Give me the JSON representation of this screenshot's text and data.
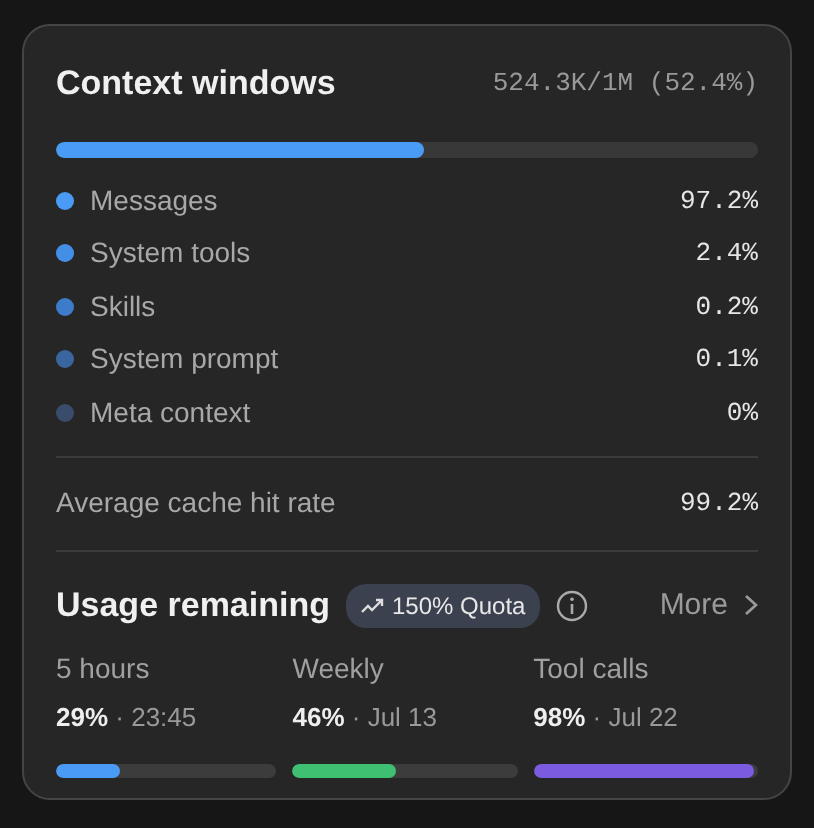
{
  "context": {
    "title": "Context windows",
    "summary": "524.3K/1M (52.4%)",
    "level": 0.524,
    "items": [
      {
        "label": "Messages",
        "value": "97.2%",
        "color": "#4a9bf5"
      },
      {
        "label": "System tools",
        "value": "2.4%",
        "color": "#438fe6"
      },
      {
        "label": "Skills",
        "value": "0.2%",
        "color": "#3d7ccb"
      },
      {
        "label": "System prompt",
        "value": "0.1%",
        "color": "#3a66a0"
      },
      {
        "label": "Meta context",
        "value": "0%",
        "color": "#394c6c"
      }
    ]
  },
  "cache": {
    "label": "Average cache hit rate",
    "value": "99.2%"
  },
  "usage": {
    "title": "Usage remaining",
    "badge": "150% Quota",
    "more": "More",
    "items": [
      {
        "label": "5 hours",
        "percent": "29%",
        "detail": "· 23:45",
        "level": 0.29,
        "color": "#4a9bf5"
      },
      {
        "label": "Weekly",
        "percent": "46%",
        "detail": "· Jul 13",
        "level": 0.46,
        "color": "#3fbf72"
      },
      {
        "label": "Tool calls",
        "percent": "98%",
        "detail": "· Jul 22",
        "level": 0.98,
        "color": "#7b5ce0"
      }
    ]
  }
}
